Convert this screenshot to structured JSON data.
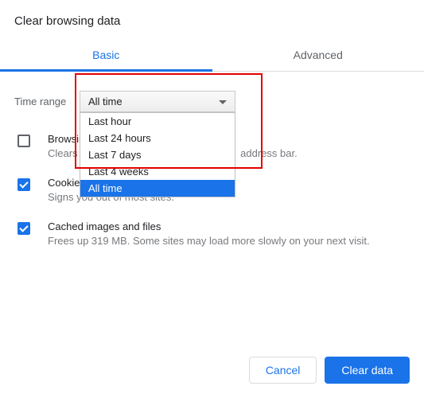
{
  "title": "Clear browsing data",
  "tabs": {
    "basic": "Basic",
    "advanced": "Advanced"
  },
  "timeRange": {
    "label": "Time range",
    "selected": "All time",
    "options": [
      "Last hour",
      "Last 24 hours",
      "Last 7 days",
      "Last 4 weeks",
      "All time"
    ]
  },
  "options": {
    "browsing": {
      "title": "Browsing history",
      "desc_prefix": "Clears",
      "desc_suffix": "address bar."
    },
    "cookies": {
      "title": "Cookies and other site data",
      "desc": "Signs you out of most sites."
    },
    "cache": {
      "title": "Cached images and files",
      "desc": "Frees up 319 MB. Some sites may load more slowly on your next visit."
    }
  },
  "buttons": {
    "cancel": "Cancel",
    "clear": "Clear data"
  }
}
